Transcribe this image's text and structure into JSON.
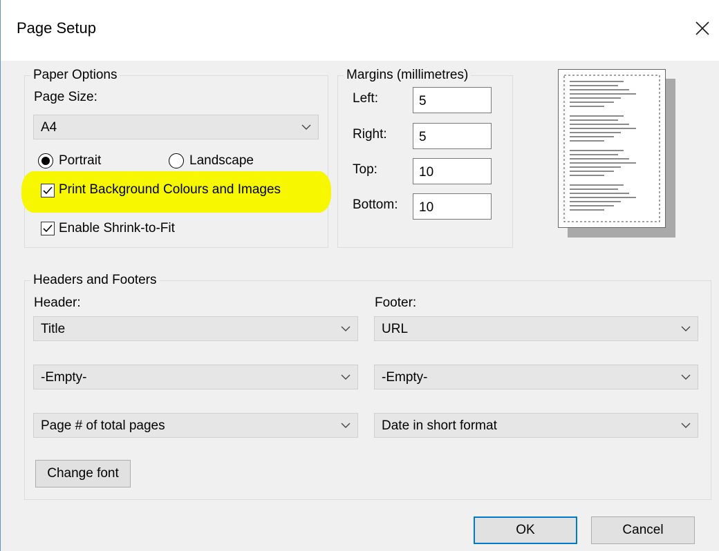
{
  "dialog": {
    "title": "Page Setup"
  },
  "paper_options": {
    "legend": "Paper Options",
    "page_size_label": "Page Size:",
    "page_size_value": "A4",
    "portrait_label": "Portrait",
    "landscape_label": "Landscape",
    "orientation": "Portrait",
    "print_background_label": "Print Background Colours and Images",
    "print_background_checked": true,
    "shrink_to_fit_label": "Enable Shrink-to-Fit",
    "shrink_to_fit_checked": true
  },
  "margins": {
    "legend": "Margins (millimetres)",
    "left_label": "Left:",
    "left_value": "5",
    "right_label": "Right:",
    "right_value": "5",
    "top_label": "Top:",
    "top_value": "10",
    "bottom_label": "Bottom:",
    "bottom_value": "10"
  },
  "headers_footers": {
    "legend": "Headers and Footers",
    "header_label": "Header:",
    "footer_label": "Footer:",
    "header_values": [
      "Title",
      "-Empty-",
      "Page # of total pages"
    ],
    "footer_values": [
      "URL",
      "-Empty-",
      "Date in short format"
    ],
    "change_font_label": "Change font"
  },
  "actions": {
    "ok_label": "OK",
    "cancel_label": "Cancel"
  },
  "colors": {
    "highlight": "#f7f700",
    "default_button_border": "#0078d7",
    "window_border": "#6b8fb8"
  }
}
